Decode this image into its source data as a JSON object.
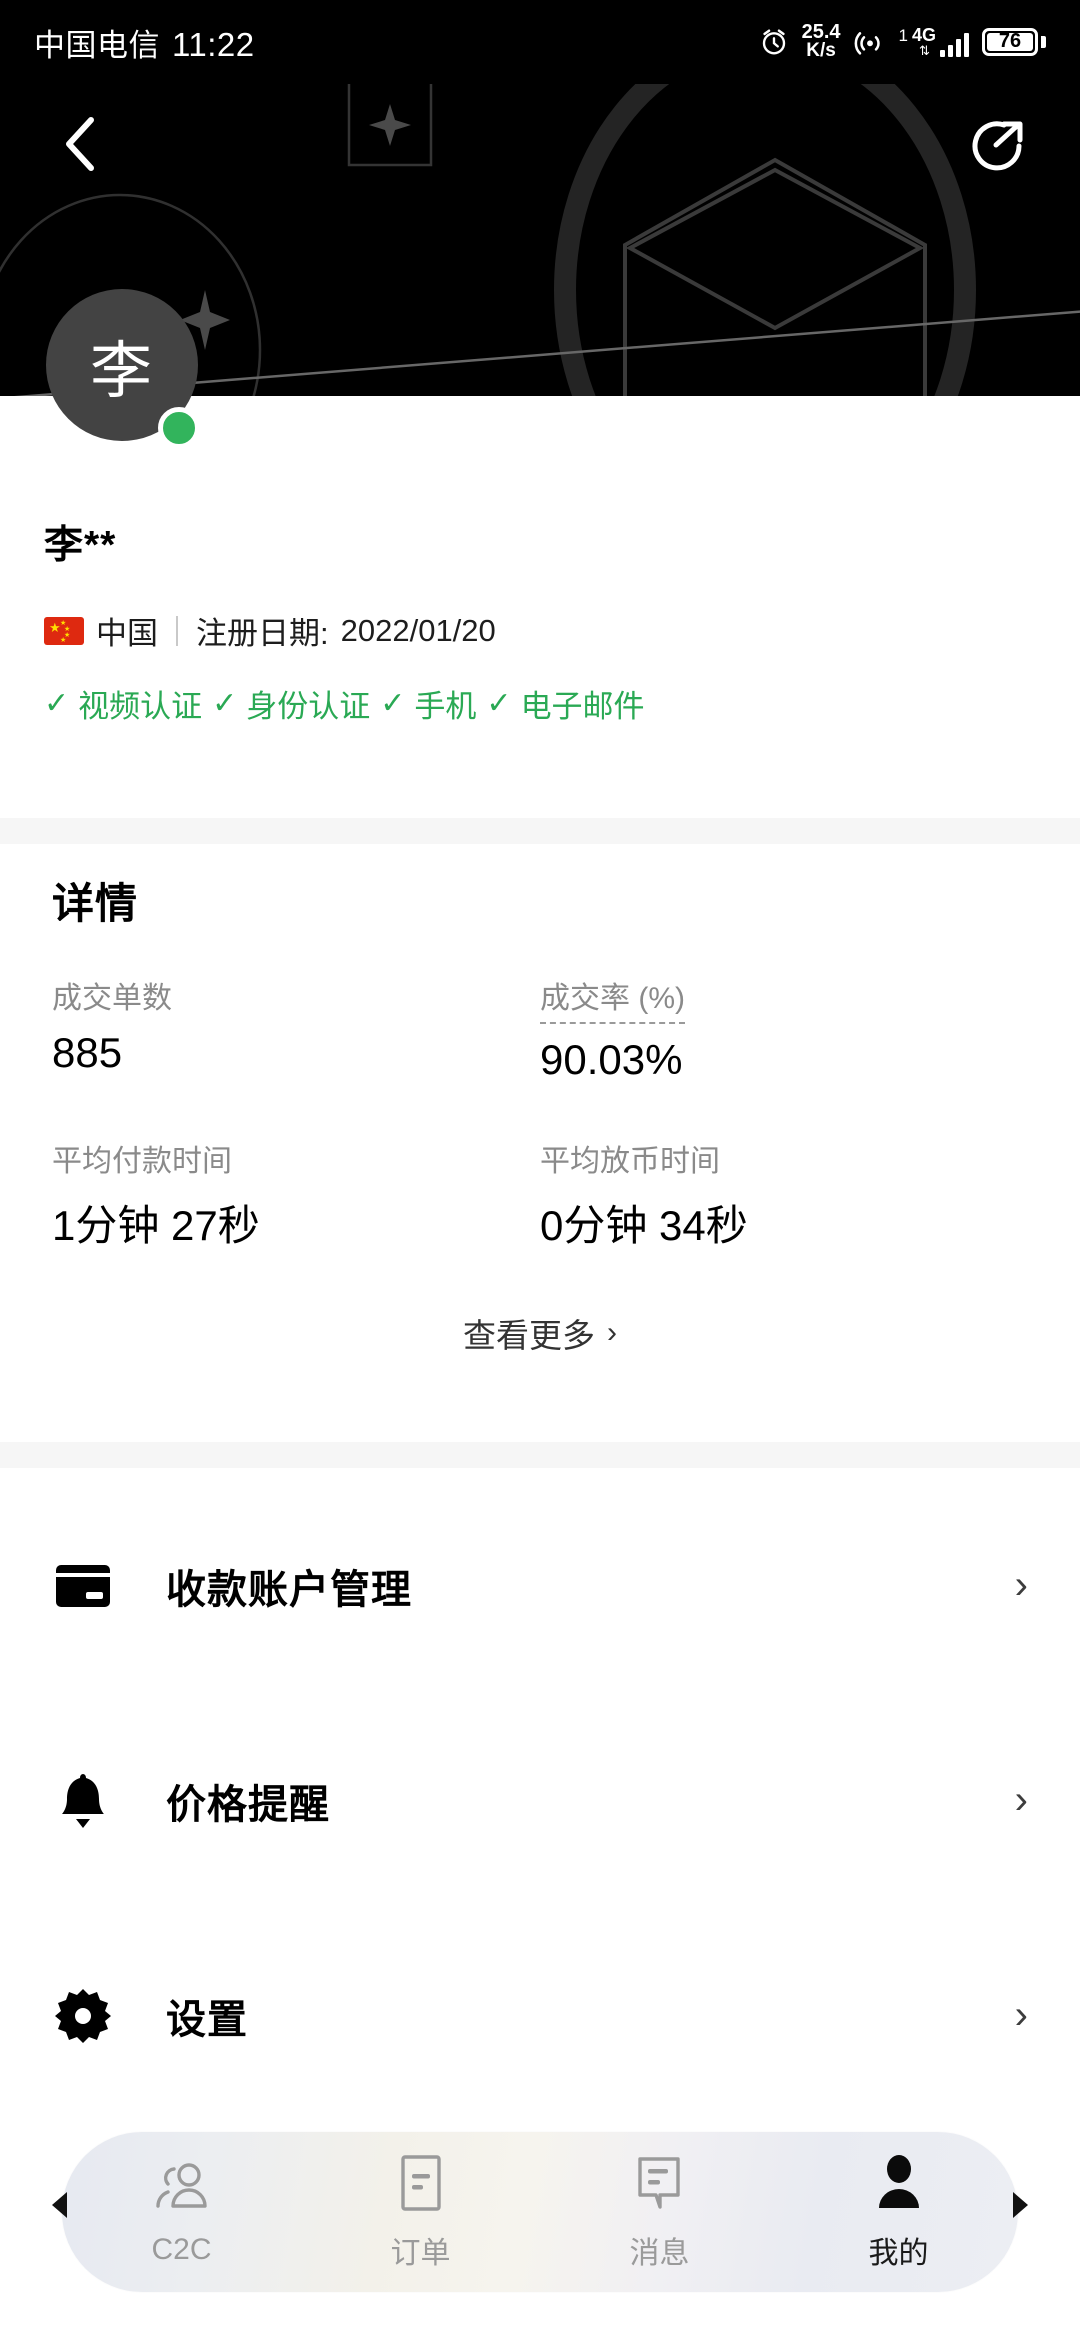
{
  "status_bar": {
    "carrier": "中国电信",
    "clock": "11:22",
    "alarm_icon": "alarm-clock-icon",
    "net_speed_value": "25.4",
    "net_speed_unit": "K/s",
    "hotspot_icon": "hotspot-icon",
    "sim_slot": "1",
    "network_type": "4G",
    "data_arrows": "⇅",
    "battery_percent": "76"
  },
  "header": {
    "back_icon": "back-chevron-icon",
    "share_icon": "share-icon",
    "background_color": "#000000"
  },
  "profile": {
    "avatar_initial": "李",
    "avatar_bg": "#434343",
    "online_status_color": "#32b45c",
    "display_name": "李**",
    "country_flag": "china-flag-icon",
    "country": "中国",
    "registration_label": "注册日期:",
    "registration_date": "2022/01/20",
    "verifications": [
      {
        "check": "✓",
        "label": "视频认证"
      },
      {
        "check": "✓",
        "label": "身份认证"
      },
      {
        "check": "✓",
        "label": "手机"
      },
      {
        "check": "✓",
        "label": "电子邮件"
      }
    ],
    "verified_color": "#2aa954"
  },
  "details": {
    "title": "详情",
    "stats": [
      {
        "label": "成交单数",
        "value": "885",
        "dotted": false
      },
      {
        "label": "成交率 (%)",
        "value": "90.03%",
        "dotted": true
      },
      {
        "label": "平均付款时间",
        "value": "1分钟 27秒",
        "dotted": false
      },
      {
        "label": "平均放币时间",
        "value": "0分钟 34秒",
        "dotted": false
      }
    ],
    "more_label": "查看更多",
    "more_chevron": "›"
  },
  "menu": {
    "items": [
      {
        "icon": "credit-card-icon",
        "label": "收款账户管理",
        "chevron": "›"
      },
      {
        "icon": "bell-icon",
        "label": "价格提醒",
        "chevron": "›"
      },
      {
        "icon": "gear-icon",
        "label": "设置",
        "chevron": "›"
      }
    ]
  },
  "tabbar": {
    "tabs": [
      {
        "icon": "people-icon",
        "label": "C2C",
        "active": false
      },
      {
        "icon": "order-document-icon",
        "label": "订单",
        "active": false
      },
      {
        "icon": "chat-bubble-icon",
        "label": "消息",
        "active": false
      },
      {
        "icon": "person-icon",
        "label": "我的",
        "active": true
      }
    ]
  }
}
